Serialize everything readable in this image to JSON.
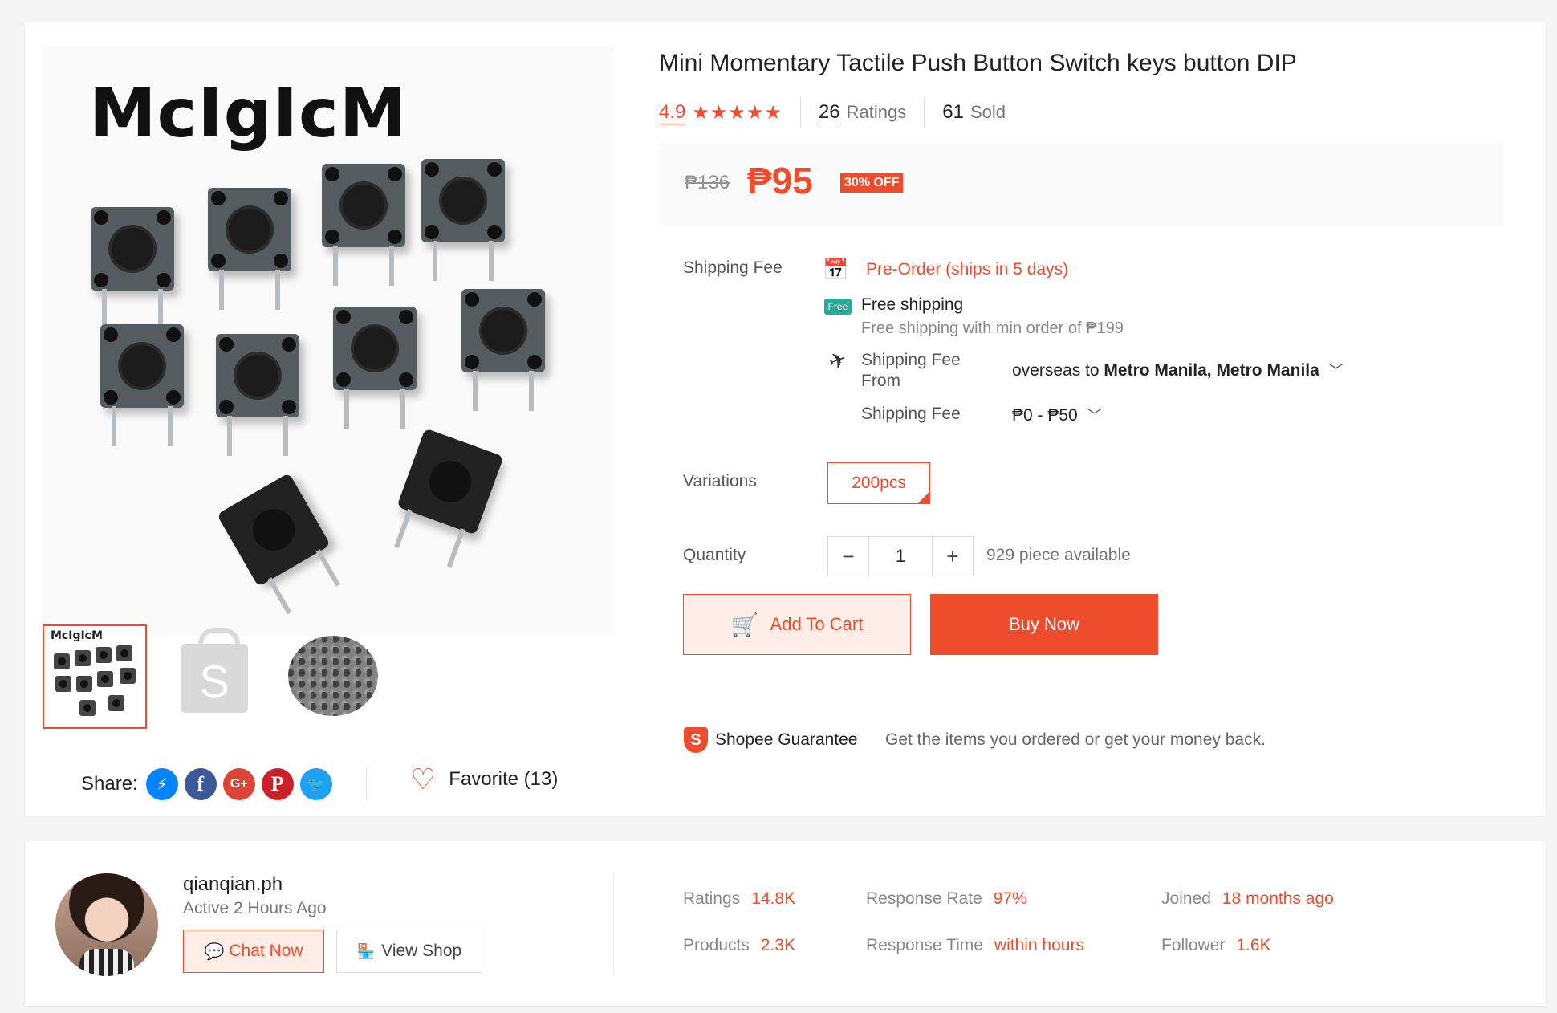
{
  "product": {
    "brand_logo": "McIgIcM",
    "title": "Mini Momentary Tactile Push Button Switch keys button DIP",
    "rating": "4.9",
    "stars": "★★★★★",
    "ratings_count": "26",
    "ratings_label": "Ratings",
    "sold_count": "61",
    "sold_label": "Sold",
    "old_price": "₱136",
    "price": "₱95",
    "discount": "30% OFF"
  },
  "gallery": {
    "thumb_logo": "McIgIcM",
    "bag_letter": "S"
  },
  "shipping": {
    "label": "Shipping Fee",
    "preorder": "Pre-Order (ships in 5 days)",
    "free_badge": "Free",
    "free_title": "Free shipping",
    "free_subtitle": "Free shipping with min order of ₱199",
    "from_label": "Shipping Fee From",
    "from_origin": "overseas",
    "from_to": "to",
    "from_destination": "Metro Manila, Metro Manila",
    "fee_label": "Shipping Fee",
    "fee_value": "₱0 - ₱50"
  },
  "variations": {
    "label": "Variations",
    "selected": "200pcs"
  },
  "quantity": {
    "label": "Quantity",
    "minus": "−",
    "value": "1",
    "plus": "+",
    "available": "929 piece available"
  },
  "actions": {
    "add_to_cart": "Add To Cart",
    "buy_now": "Buy Now"
  },
  "guarantee": {
    "label": "Shopee Guarantee",
    "text": "Get the items you ordered or get your money back."
  },
  "share": {
    "label": "Share:",
    "networks": [
      "messenger",
      "facebook",
      "google-plus",
      "pinterest",
      "twitter"
    ]
  },
  "favorite": {
    "label": "Favorite (13)"
  },
  "seller": {
    "name": "qianqian.ph",
    "active": "Active 2 Hours Ago",
    "chat_label": "Chat Now",
    "view_label": "View Shop",
    "stats": {
      "ratings_k": "Ratings",
      "ratings_v": "14.8K",
      "products_k": "Products",
      "products_v": "2.3K",
      "response_rate_k": "Response Rate",
      "response_rate_v": "97%",
      "response_time_k": "Response Time",
      "response_time_v": "within hours",
      "joined_k": "Joined",
      "joined_v": "18 months ago",
      "follower_k": "Follower",
      "follower_v": "1.6K"
    }
  },
  "colors": {
    "accent": "#ee4d2d",
    "free_badge": "#26aa99",
    "messenger": "#0084ff",
    "facebook": "#3b5998",
    "google_plus": "#db4437",
    "pinterest": "#cb2027",
    "twitter": "#1da1f2"
  }
}
